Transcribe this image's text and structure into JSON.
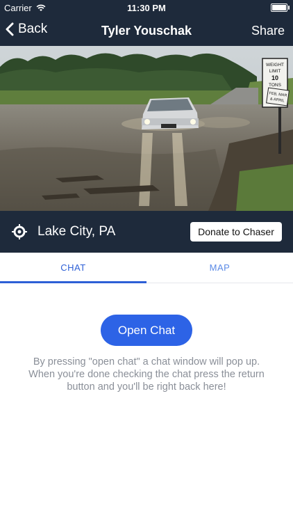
{
  "status_bar": {
    "carrier": "Carrier",
    "time": "11:30 PM"
  },
  "nav": {
    "back_label": "Back",
    "title": "Tyler Youschak",
    "share_label": "Share"
  },
  "hero": {
    "sign_lines": [
      "WEIGHT",
      "LIMIT",
      "10",
      "TONS",
      "FEB, MAR",
      "& APRIL"
    ]
  },
  "location": {
    "name": "Lake City, PA",
    "donate_label": "Donate to Chaser"
  },
  "tabs": {
    "chat": "CHAT",
    "map": "MAP",
    "active": "chat"
  },
  "chat": {
    "button_label": "Open Chat",
    "info_lines": [
      "By pressing \"open chat\" a chat window will pop up.",
      "When you're done checking the chat press the return",
      "button and you'll be right back here!"
    ]
  },
  "colors": {
    "nav_bg": "#1e2a3b",
    "accent": "#2d63e6",
    "tab_active": "#2d5fd6"
  }
}
